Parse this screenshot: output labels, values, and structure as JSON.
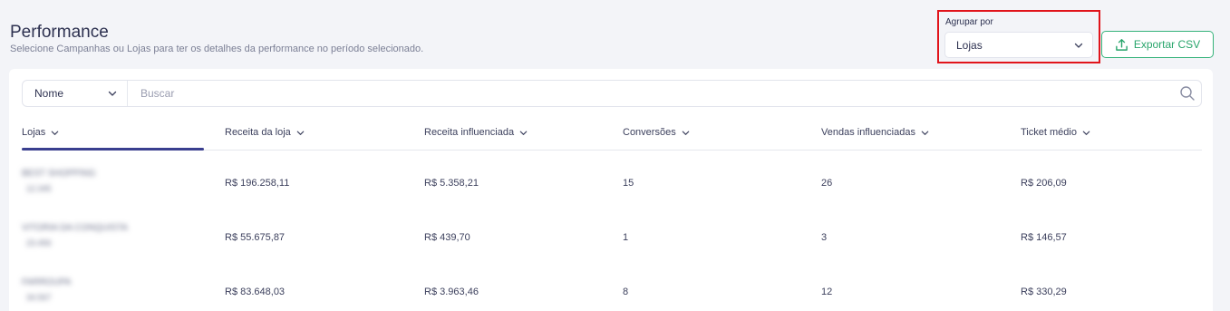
{
  "header": {
    "title": "Performance",
    "subtitle": "Selecione Campanhas ou Lojas para ter os detalhes da performance no período selecionado."
  },
  "group_by": {
    "label": "Agrupar por",
    "selected": "Lojas"
  },
  "export": {
    "label": "Exportar CSV"
  },
  "search": {
    "filter_field": "Nome",
    "placeholder": "Buscar"
  },
  "table": {
    "columns": [
      "Lojas",
      "Receita da loja",
      "Receita influenciada",
      "Conversões",
      "Vendas influenciadas",
      "Ticket médio"
    ],
    "rows": [
      {
        "store_name": "BEST SHOPPING",
        "store_id": "12.345",
        "receita_loja": "R$ 196.258,11",
        "receita_influenciada": "R$ 5.358,21",
        "conversoes": "15",
        "vendas_influenciadas": "26",
        "ticket_medio": "R$ 206,09"
      },
      {
        "store_name": "VITORIA DA CONQUISTA",
        "store_id": "23.456",
        "receita_loja": "R$ 55.675,87",
        "receita_influenciada": "R$ 439,70",
        "conversoes": "1",
        "vendas_influenciadas": "3",
        "ticket_medio": "R$ 146,57"
      },
      {
        "store_name": "FARROUPA",
        "store_id": "34.567",
        "receita_loja": "R$ 83.648,03",
        "receita_influenciada": "R$ 3.963,46",
        "conversoes": "8",
        "vendas_influenciadas": "12",
        "ticket_medio": "R$ 330,29"
      }
    ]
  },
  "colors": {
    "accent_green": "#28a56b",
    "highlight_red": "#e1141b",
    "active_tab": "#3a3f8f"
  }
}
